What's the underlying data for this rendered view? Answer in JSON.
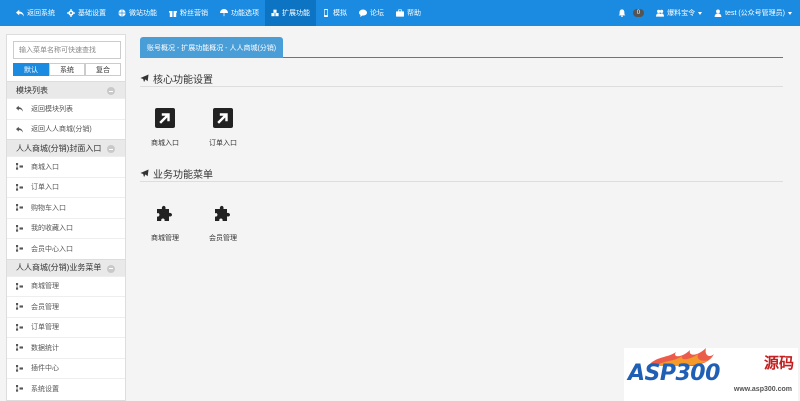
{
  "nav": {
    "items": [
      {
        "label": "返回系统",
        "icon": "reply-icon"
      },
      {
        "label": "基础设置",
        "icon": "gear-icon"
      },
      {
        "label": "微站功能",
        "icon": "globe-icon"
      },
      {
        "label": "粉丝营销",
        "icon": "gift-icon"
      },
      {
        "label": "功能选项",
        "icon": "umbrella-icon"
      },
      {
        "label": "扩展功能",
        "icon": "cubes-icon"
      },
      {
        "label": "模拟",
        "icon": "mobile-icon"
      },
      {
        "label": "论坛",
        "icon": "comment-icon"
      },
      {
        "label": "帮助",
        "icon": "briefcase-icon"
      }
    ],
    "active_index": 5,
    "notification_count": "0",
    "marketing_label": "爆料宝令",
    "user_label": "test (公众号管理员)"
  },
  "sidebar": {
    "search_placeholder": "输入菜单名称可快速查找",
    "tabs": [
      "默认",
      "系统",
      "复合"
    ],
    "sections": [
      {
        "title": "模块列表",
        "items": [
          "返回模块列表",
          "返回人人商城(分销)"
        ],
        "icon": "reply-icon"
      },
      {
        "title": "人人商城(分销)封面入口",
        "items": [
          "商城入口",
          "订单入口",
          "购物车入口",
          "我的收藏入口",
          "会员中心入口"
        ],
        "icon": "sitemap-icon"
      },
      {
        "title": "人人商城(分销)业务菜单",
        "items": [
          "商城管理",
          "会员管理",
          "订单管理",
          "数据统计",
          "插件中心",
          "系统设置"
        ],
        "icon": "sitemap-icon"
      }
    ]
  },
  "main": {
    "breadcrumb": "账号概况 - 扩展功能概况 - 人人商城(分销)",
    "core_section": {
      "title": "核心功能设置",
      "tiles": [
        "商城入口",
        "订单入口"
      ]
    },
    "business_section": {
      "title": "业务功能菜单",
      "tiles": [
        "商城管理",
        "会员管理"
      ]
    }
  },
  "watermark": {
    "brand": "ASP300",
    "cn": "源码",
    "url": "www.asp300.com"
  },
  "colors": {
    "primary": "#1a8be0",
    "active_nav": "#0d74c4",
    "breadcrumb": "#4a9ed8"
  }
}
